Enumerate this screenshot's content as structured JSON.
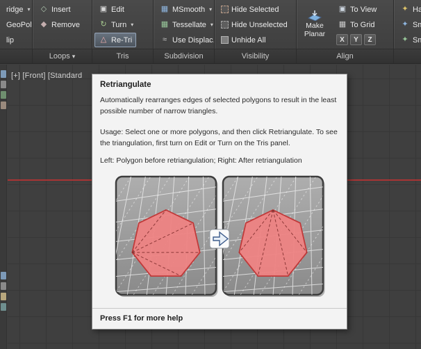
{
  "ribbon": {
    "edge_left": {
      "bridge": "ridge",
      "geopoly": "GeoPoly",
      "flip": "lip"
    },
    "loops": {
      "insert": "Insert",
      "remove": "Remove",
      "label": "Loops"
    },
    "tris": {
      "edit": "Edit",
      "turn": "Turn",
      "retri": "Re-Tri",
      "label": "Tris"
    },
    "subdivision": {
      "msmooth": "MSmooth",
      "tessellate": "Tessellate",
      "use_displace": "Use Displac...",
      "label": "Subdivision"
    },
    "visibility": {
      "hide_selected": "Hide Selected",
      "hide_unselected": "Hide Unselected",
      "unhide_all": "Unhide All",
      "label": "Visibility"
    },
    "align": {
      "make_planar": "Make Planar",
      "to_view": "To View",
      "to_grid": "To Grid",
      "x": "X",
      "y": "Y",
      "z": "Z",
      "label": "Align"
    },
    "edge_right": {
      "hard": "Har",
      "smooth_a": "Smo",
      "smooth_b": "Smo"
    }
  },
  "icons": {
    "insert": "◇",
    "remove": "◆",
    "edit": "▣",
    "turn": "↻",
    "retri": "△",
    "msmooth": "▦",
    "tessellate": "▦",
    "use_displace": "≈",
    "to_view": "▣",
    "to_grid": "▦",
    "hard": "✦",
    "smooth_a": "✦",
    "smooth_b": "✦"
  },
  "viewport": {
    "label": "[+]  [Front]  [Standard"
  },
  "tooltip": {
    "title": "Retriangulate",
    "p1": "Automatically rearranges edges of selected polygons to result in the least possible number of narrow triangles.",
    "p2": "Usage: Select one or more polygons, and then click Retriangulate. To see the triangulation, first turn on Edit or Turn on the Tris panel.",
    "p3": "Left: Polygon before retriangulation; Right: After retriangulation",
    "footer": "Press F1 for more help"
  },
  "colors": {
    "ribbon_bg": "#424242",
    "viewport_bg": "#3f3f3f",
    "axis_red": "#a93434",
    "highlight_border": "#95a6ba",
    "polygon_fill": "#ee8383",
    "polygon_stroke": "#c03a3a"
  }
}
